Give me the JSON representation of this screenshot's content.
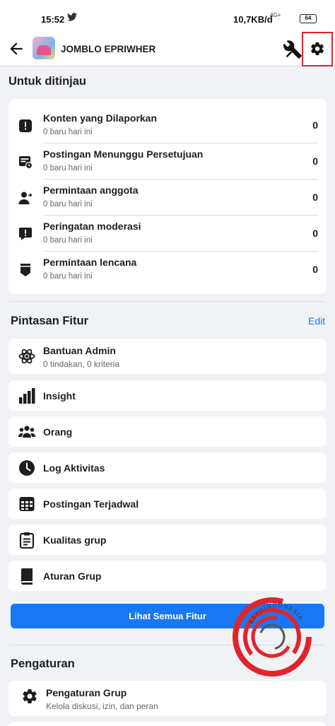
{
  "status_bar": {
    "time": "15:52",
    "network_speed": "10,7KB/d",
    "network_label": "4G+",
    "battery": "64"
  },
  "header": {
    "group_name": "JOMBLO EPRIWHER",
    "icons": [
      "back-arrow-icon",
      "tools-icon",
      "gear-icon"
    ]
  },
  "review": {
    "title": "Untuk ditinjau",
    "items": [
      {
        "label": "Konten yang Dilaporkan",
        "sub": "0 baru hari ini",
        "count": "0",
        "icon": "alert-icon"
      },
      {
        "label": "Postingan Menunggu Persetujuan",
        "sub": "0 baru hari ini",
        "count": "0",
        "icon": "pending-post-icon"
      },
      {
        "label": "Permintaan anggota",
        "sub": "0 baru hari ini",
        "count": "0",
        "icon": "member-request-icon"
      },
      {
        "label": "Peringatan moderasi",
        "sub": "0 baru hari ini",
        "count": "0",
        "icon": "moderation-alert-icon"
      },
      {
        "label": "Permintaan lencana",
        "sub": "0 baru hari ini",
        "count": "0",
        "icon": "badge-icon"
      }
    ]
  },
  "features": {
    "title": "Pintasan Fitur",
    "edit_label": "Edit",
    "items": [
      {
        "label": "Bantuan Admin",
        "sub": "0 tindakan, 0 kriteria",
        "icon": "atom-icon"
      },
      {
        "label": "Insight",
        "icon": "bar-chart-icon"
      },
      {
        "label": "Orang",
        "icon": "people-icon"
      },
      {
        "label": "Log Aktivitas",
        "icon": "clock-icon"
      },
      {
        "label": "Postingan Terjadwal",
        "icon": "calendar-icon"
      },
      {
        "label": "Kualitas grup",
        "icon": "clipboard-icon"
      },
      {
        "label": "Aturan Grup",
        "icon": "rulebook-icon"
      }
    ],
    "see_all_label": "Lihat Semua Fitur"
  },
  "settings": {
    "title": "Pengaturan",
    "items": [
      {
        "label": "Pengaturan Grup",
        "sub": "Kelola diskusi, izin, dan peran",
        "icon": "gear-icon"
      }
    ]
  },
  "watermark": {
    "text": "KEPOINDONESIA"
  },
  "colors": {
    "accent": "#1877f2",
    "highlight": "#e0242c",
    "background": "#f0f2f5",
    "muted_text": "#65676b"
  }
}
